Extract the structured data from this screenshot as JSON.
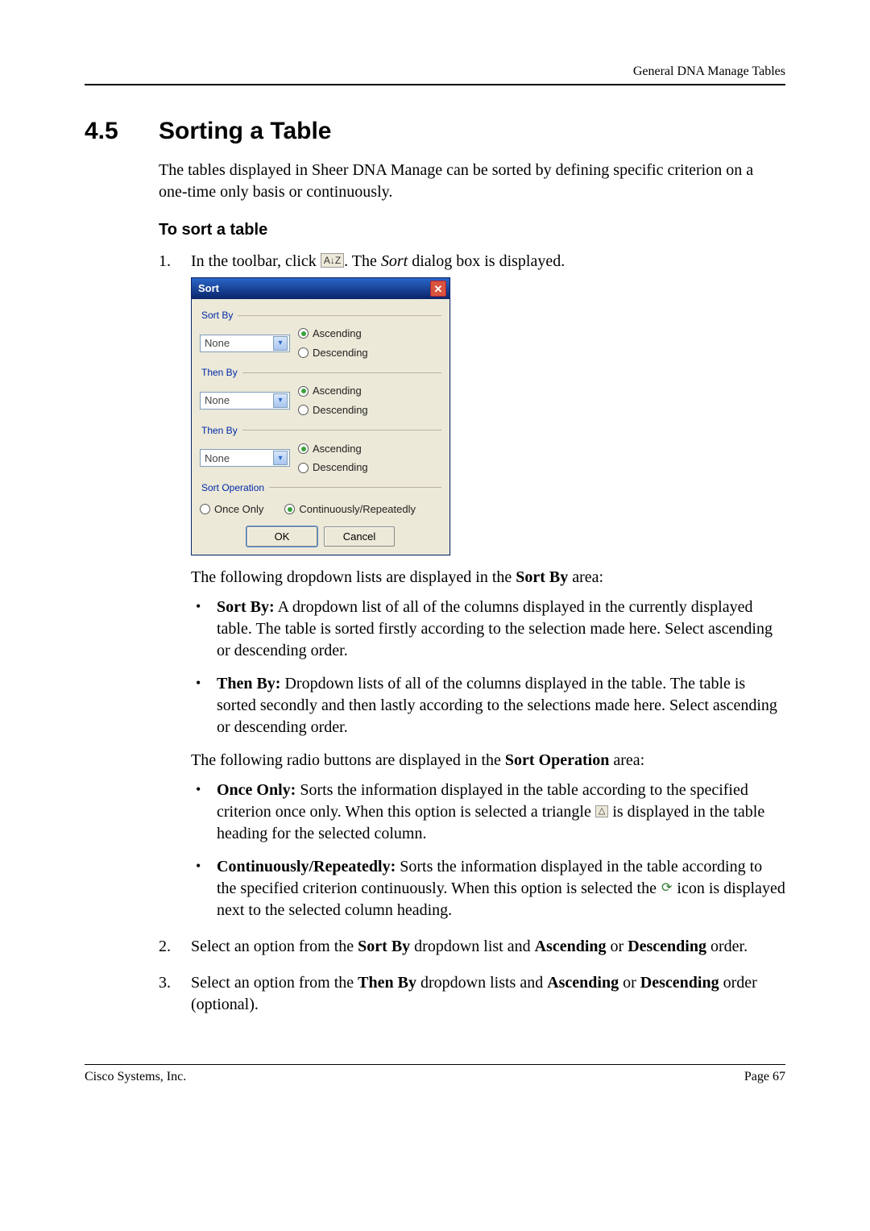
{
  "header": {
    "right": "General DNA Manage Tables"
  },
  "section": {
    "number": "4.5",
    "title": "Sorting a Table"
  },
  "intro": "The tables displayed in Sheer DNA Manage can be sorted by defining specific criterion on a one-time only basis or continuously.",
  "subhead": "To sort a table",
  "step1": {
    "num": "1.",
    "pre": "In the toolbar, click ",
    "icon": "A↓Z",
    "post_a": ". The ",
    "italic": "Sort",
    "post_b": " dialog box is displayed."
  },
  "dialog": {
    "title": "Sort",
    "close": "✕",
    "groups": [
      {
        "legend": "Sort By",
        "value": "None",
        "asc": "Ascending",
        "desc": "Descending",
        "selected": "asc"
      },
      {
        "legend": "Then By",
        "value": "None",
        "asc": "Ascending",
        "desc": "Descending",
        "selected": "asc"
      },
      {
        "legend": "Then By",
        "value": "None",
        "asc": "Ascending",
        "desc": "Descending",
        "selected": "asc"
      }
    ],
    "operation": {
      "legend": "Sort Operation",
      "once": "Once Only",
      "cont": "Continuously/Repeatedly",
      "selected": "cont"
    },
    "ok": "OK",
    "cancel": "Cancel"
  },
  "after_dialog": {
    "para1_a": "The following dropdown lists are displayed in the ",
    "para1_b": "Sort By",
    "para1_c": " area:",
    "bul1": {
      "b": "Sort By:",
      "t": " A dropdown list of all of the columns displayed in the currently displayed table. The table is sorted firstly according to the selection made here. Select ascending or descending order."
    },
    "bul2": {
      "b": "Then By:",
      "t": " Dropdown lists of all of the columns displayed in the table. The table is sorted secondly and then lastly according to the selections made here. Select ascending or descending order."
    },
    "para2_a": "The following radio buttons are displayed in the ",
    "para2_b": "Sort Operation",
    "para2_c": " area:",
    "bul3": {
      "b": "Once Only:",
      "t1": " Sorts the information displayed in the table according to the specified criterion once only. When this option is selected a triangle ",
      "icon": "△",
      "t2": " is displayed in the table heading for the selected column."
    },
    "bul4": {
      "b": "Continuously/Repeatedly:",
      "t1": " Sorts the information displayed in the table according to the specified criterion continuously. When this option is selected the ",
      "icon": "⟳",
      "t2": " icon is displayed next to the selected column heading."
    }
  },
  "step2": {
    "num": "2.",
    "a": "Select an option from the ",
    "b": "Sort By",
    "c": " dropdown list and ",
    "d": "Ascending",
    "e": " or ",
    "f": "Descending",
    "g": " order."
  },
  "step3": {
    "num": "3.",
    "a": "Select an option from the ",
    "b": "Then By",
    "c": " dropdown lists and ",
    "d": "Ascending",
    "e": " or ",
    "f": "Descending",
    "g": " order (optional)."
  },
  "footer": {
    "left": "Cisco Systems, Inc.",
    "right": "Page 67"
  }
}
